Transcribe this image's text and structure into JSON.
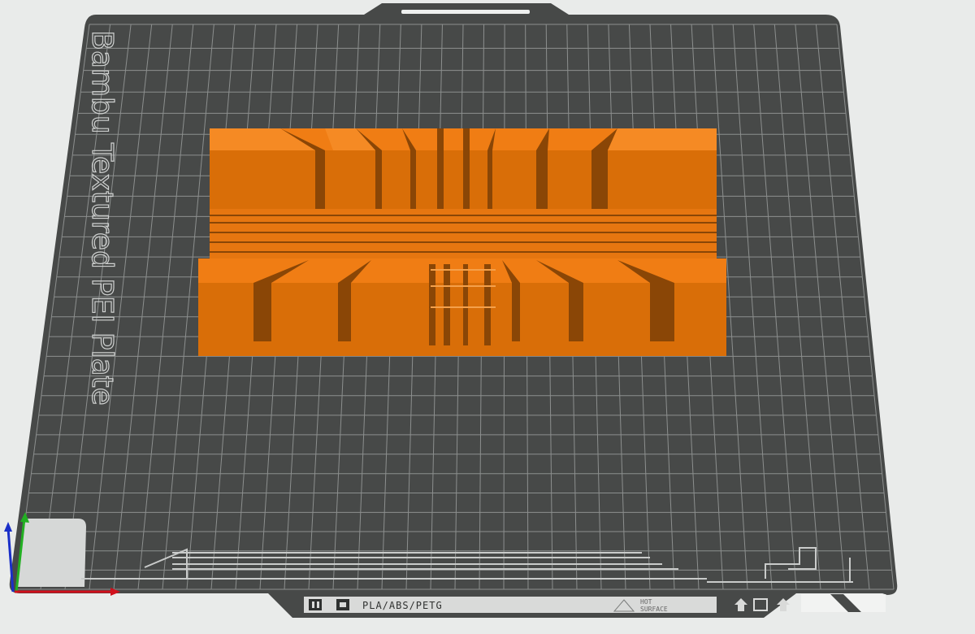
{
  "plate": {
    "title": "Bambu Textured PEI Plate",
    "materials": "PLA/ABS/PETG",
    "hot_line1": "HOT",
    "hot_line2": "SURFACE",
    "plate_color": "#474948",
    "grid_color": "#8c8f8e",
    "background_color": "#e9ebea"
  },
  "model": {
    "color_top": "#f07d14",
    "color_front": "#d96e08",
    "color_shadow": "#8a4606"
  },
  "axes": {
    "x_color": "#d0101c",
    "y_color": "#22b022",
    "z_color": "#1a2fc8"
  }
}
